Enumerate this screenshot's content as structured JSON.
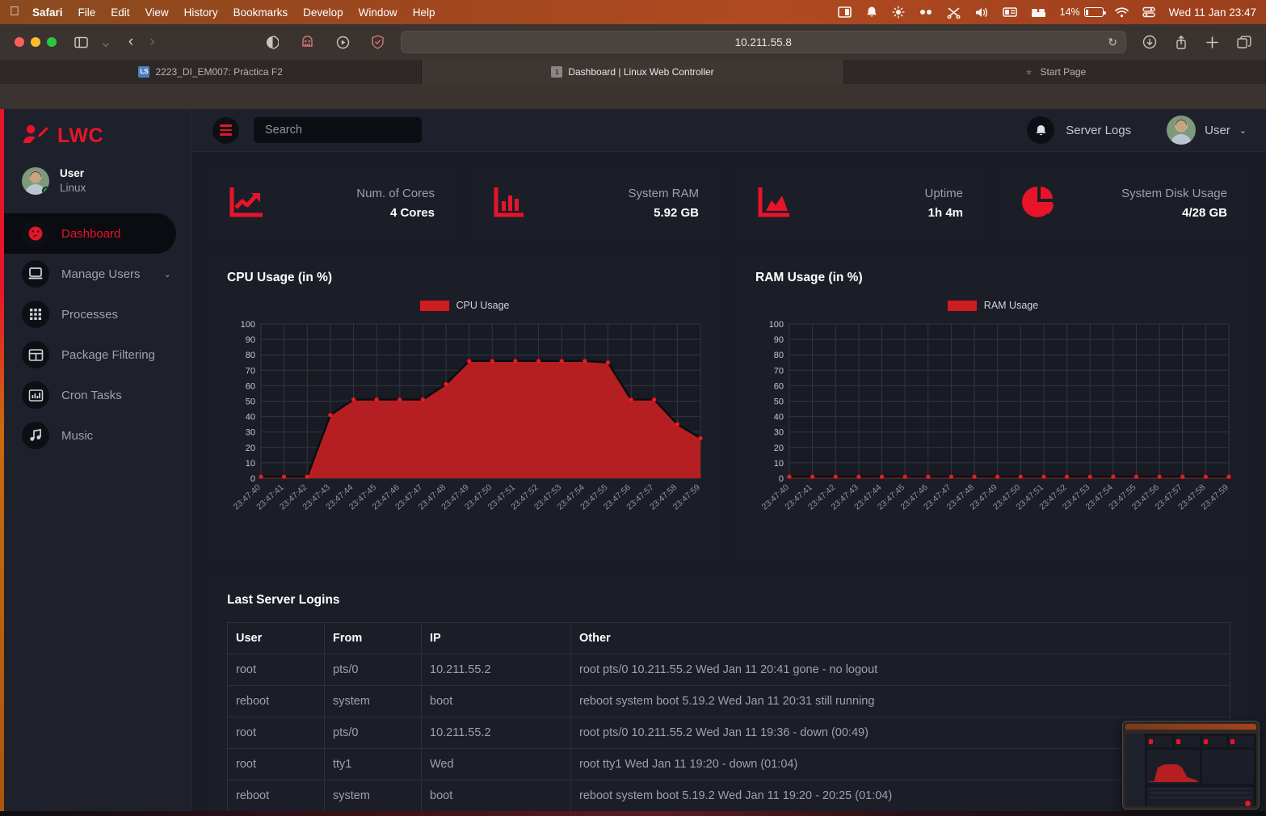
{
  "menubar": {
    "apple_icon": "apple-icon",
    "items": [
      {
        "label": "Safari",
        "bold": true
      },
      {
        "label": "File",
        "bold": false
      },
      {
        "label": "Edit",
        "bold": false
      },
      {
        "label": "View",
        "bold": false
      },
      {
        "label": "History",
        "bold": false
      },
      {
        "label": "Bookmarks",
        "bold": false
      },
      {
        "label": "Develop",
        "bold": false
      },
      {
        "label": "Window",
        "bold": false
      },
      {
        "label": "Help",
        "bold": false
      }
    ],
    "status_icons": [
      "screen-mirroring-icon",
      "notification-bell-icon",
      "brightness-icon",
      "dual-dot-icon",
      "scissors-icon",
      "volume-icon",
      "keyboard-icon",
      "bed-icon"
    ],
    "battery_percent": "14%",
    "wifi_icon": "wifi-icon",
    "controlcenter_icon": "control-center-icon",
    "clock": "Wed 11 Jan  23:47"
  },
  "browser": {
    "window_controls": [
      "close",
      "minimize",
      "zoom"
    ],
    "sidebar_toggle_icon": "sidebar-toggle-icon",
    "back_icon": "back-chevron-icon",
    "forward_icon": "forward-chevron-icon",
    "toolbar_icons": [
      "reader-icon",
      "privacy-report-icon",
      "play-icon",
      "shield-icon"
    ],
    "url": "10.211.55.8",
    "reload_icon": "reload-icon",
    "right_icons": [
      "download-icon",
      "share-icon",
      "new-tab-icon",
      "tab-overview-icon"
    ],
    "tabs": [
      {
        "title": "2223_DI_EM007: Pràctica F2",
        "favicon": "LS",
        "favicon_type": "ls",
        "active": false
      },
      {
        "title": "Dashboard | Linux Web Controller",
        "favicon": "1",
        "favicon_type": "num",
        "active": true
      },
      {
        "title": "Start Page",
        "favicon": "☆",
        "favicon_type": "star",
        "active": false
      }
    ]
  },
  "app": {
    "brand": "LWC",
    "brand_icon": "user-edit-icon",
    "profile": {
      "name": "User",
      "role": "Linux",
      "avatar": "user-avatar",
      "status": "online"
    },
    "sidebar": [
      {
        "label": "Dashboard",
        "icon": "speedometer-icon",
        "active": true,
        "caret": ""
      },
      {
        "label": "Manage Users",
        "icon": "monitor-icon",
        "active": false,
        "caret": "⌄"
      },
      {
        "label": "Processes",
        "icon": "grid-dots-icon",
        "active": false,
        "caret": ""
      },
      {
        "label": "Package Filtering",
        "icon": "table-icon",
        "active": false,
        "caret": ""
      },
      {
        "label": "Cron Tasks",
        "icon": "bar-chart-icon",
        "active": false,
        "caret": ""
      },
      {
        "label": "Music",
        "icon": "music-note-icon",
        "active": false,
        "caret": ""
      }
    ],
    "topbar": {
      "menu_icon": "hamburger-icon",
      "search_placeholder": "Search",
      "search_value": "",
      "bell_icon": "bell-icon",
      "server_logs_label": "Server Logs",
      "user_label": "User",
      "user_caret": "⌄"
    },
    "stat_cards": [
      {
        "label": "Num. of Cores",
        "value": "4 Cores",
        "icon": "line-chart-up-icon"
      },
      {
        "label": "System RAM",
        "value": "5.92 GB",
        "icon": "bar-chart-icon"
      },
      {
        "label": "Uptime",
        "value": "1h 4m",
        "icon": "area-chart-icon"
      },
      {
        "label": "System Disk Usage",
        "value": "4/28 GB",
        "icon": "pie-chart-icon"
      }
    ],
    "cpu_card_title": "CPU Usage (in %)",
    "ram_card_title": "RAM Usage (in %)",
    "table": {
      "title": "Last Server Logins",
      "columns": [
        "User",
        "From",
        "IP",
        "Other"
      ],
      "rows": [
        [
          "root",
          "pts/0",
          "10.211.55.2",
          "root pts/0 10.211.55.2 Wed Jan 11 20:41 gone - no logout"
        ],
        [
          "reboot",
          "system",
          "boot",
          "reboot system boot 5.19.2 Wed Jan 11 20:31 still running"
        ],
        [
          "root",
          "pts/0",
          "10.211.55.2",
          "root pts/0 10.211.55.2 Wed Jan 11 19:36 - down (00:49)"
        ],
        [
          "root",
          "tty1",
          "Wed",
          "root tty1 Wed Jan 11 19:20 - down (01:04)"
        ],
        [
          "reboot",
          "system",
          "boot",
          "reboot system boot 5.19.2 Wed Jan 11 19:20 - 20:25 (01:04)"
        ]
      ]
    },
    "colors": {
      "accent_red": "#e8142a",
      "chart_fill": "#b51f22",
      "page_bg": "#1a1d26",
      "card_bg": "#1b1e27",
      "sidebar_bg": "#1e212b"
    }
  },
  "pip": {
    "label": "picture-in-picture-preview"
  },
  "chart_data": [
    {
      "type": "area",
      "title": "CPU Usage (in %)",
      "legend": [
        "CPU Usage"
      ],
      "legend_position": "top-center",
      "xlabel": "",
      "ylabel": "",
      "ylim": [
        0,
        100
      ],
      "yticks": [
        0,
        10,
        20,
        30,
        40,
        50,
        60,
        70,
        80,
        90,
        100
      ],
      "grid": true,
      "categories": [
        "23:47:40",
        "23:47:41",
        "23:47:42",
        "23:47:43",
        "23:47:44",
        "23:47:45",
        "23:47:46",
        "23:47:47",
        "23:47:48",
        "23:47:49",
        "23:47:50",
        "23:47:51",
        "23:47:52",
        "23:47:53",
        "23:47:54",
        "23:47:55",
        "23:47:56",
        "23:47:57",
        "23:47:58",
        "23:47:59"
      ],
      "series": [
        {
          "name": "CPU Usage",
          "values": [
            1,
            1,
            1,
            41,
            51,
            51,
            51,
            51,
            61,
            76,
            76,
            76,
            76,
            76,
            76,
            75,
            51,
            51,
            35,
            26
          ]
        }
      ]
    },
    {
      "type": "area",
      "title": "RAM Usage (in %)",
      "legend": [
        "RAM Usage"
      ],
      "legend_position": "top-center",
      "xlabel": "",
      "ylabel": "",
      "ylim": [
        0,
        100
      ],
      "yticks": [
        0,
        10,
        20,
        30,
        40,
        50,
        60,
        70,
        80,
        90,
        100
      ],
      "grid": true,
      "categories": [
        "23:47:40",
        "23:47:41",
        "23:47:42",
        "23:47:43",
        "23:47:44",
        "23:47:45",
        "23:47:46",
        "23:47:47",
        "23:47:48",
        "23:47:49",
        "23:47:50",
        "23:47:51",
        "23:47:52",
        "23:47:53",
        "23:47:54",
        "23:47:55",
        "23:47:56",
        "23:47:57",
        "23:47:58",
        "23:47:59"
      ],
      "series": [
        {
          "name": "RAM Usage",
          "values": [
            1,
            1,
            1,
            1,
            1,
            1,
            1,
            1,
            1,
            1,
            1,
            1,
            1,
            1,
            1,
            1,
            1,
            1,
            1,
            1
          ]
        }
      ]
    }
  ]
}
